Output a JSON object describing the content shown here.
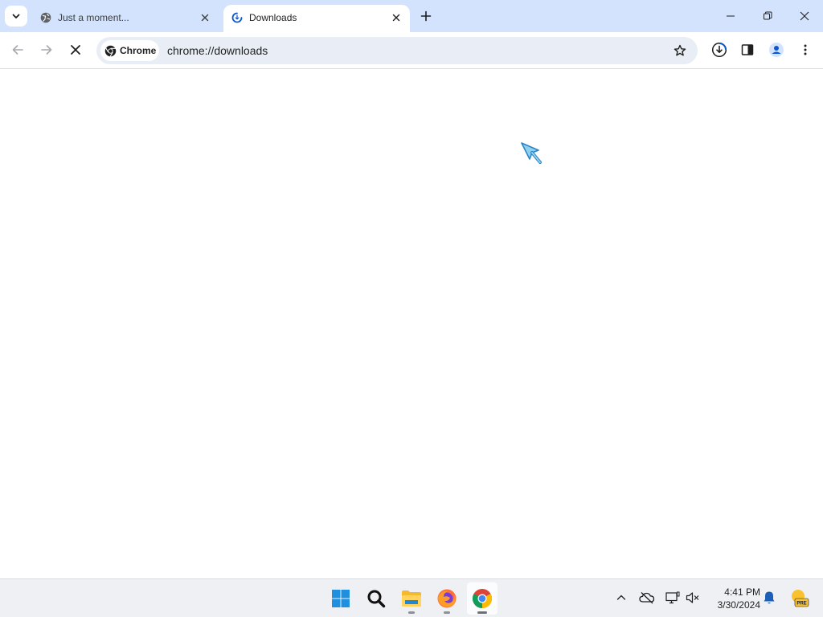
{
  "browser": {
    "tabs": [
      {
        "title": "Just a moment...",
        "favicon": "globe-icon",
        "active": false
      },
      {
        "title": "Downloads",
        "favicon": "loading-spinner-icon",
        "active": true
      }
    ],
    "tab_search_icon": "chevron-down-icon",
    "new_tab_icon": "plus-icon",
    "window_controls": [
      "minimize-icon",
      "restore-icon",
      "close-icon"
    ]
  },
  "toolbar": {
    "back_icon": "arrow-left-icon",
    "forward_icon": "arrow-right-icon",
    "stop_icon": "close-icon",
    "site_chip_label": "Chrome",
    "url": "chrome://downloads",
    "bookmark_icon": "star-icon",
    "download_icon": "download-icon",
    "side_panel_icon": "side-panel-icon",
    "profile_icon": "profile-icon",
    "menu_icon": "kebab-menu-icon"
  },
  "taskbar": {
    "apps": [
      "windows-start-icon",
      "search-icon",
      "file-explorer-icon",
      "firefox-icon",
      "chrome-icon"
    ],
    "active_app": "chrome-icon",
    "tray": [
      "chevron-up-icon",
      "onedrive-offline-icon",
      "display-icon",
      "mute-icon"
    ],
    "time": "4:41 PM",
    "date": "3/30/2024",
    "badge_label": "PRE"
  },
  "colors": {
    "tabstrip_bg": "#d3e3fd",
    "omnibox_bg": "#e9eef6",
    "taskbar_bg": "#eef0f4",
    "accent_blue": "#0b57d0"
  }
}
